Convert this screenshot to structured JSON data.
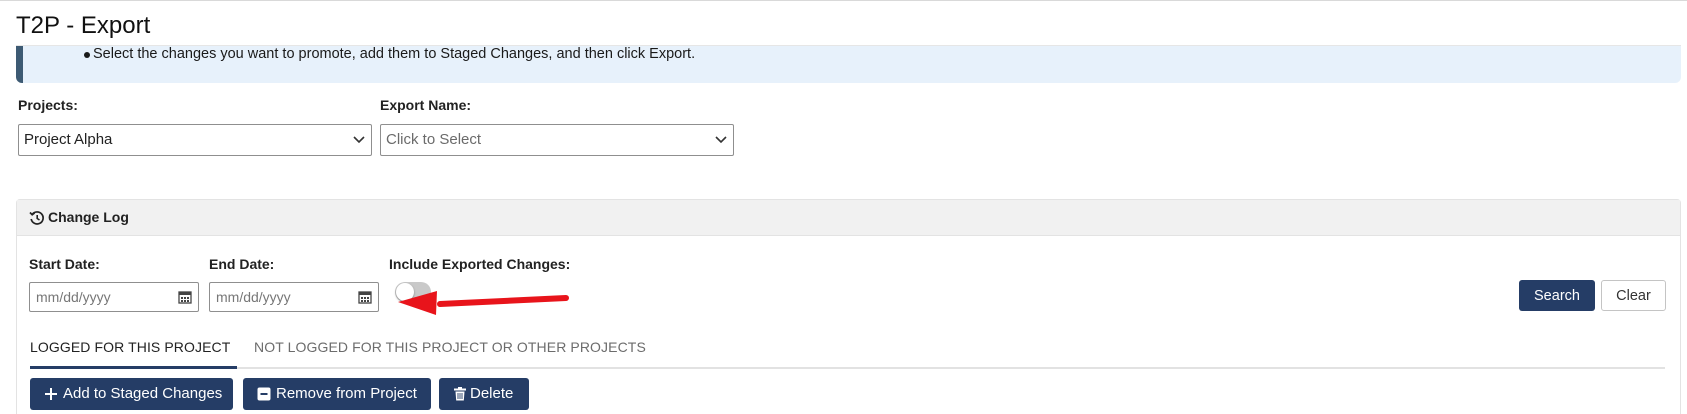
{
  "page": {
    "title": "T2P - Export"
  },
  "info": {
    "bullet_text": "Select the changes you want to promote, add them to Staged Changes, and then click Export."
  },
  "projects": {
    "label": "Projects:",
    "selected": "Project Alpha"
  },
  "export_name": {
    "label": "Export Name:",
    "placeholder": "Click to Select"
  },
  "change_log": {
    "title": "Change Log",
    "start_date": {
      "label": "Start Date:",
      "placeholder": "mm/dd/yyyy"
    },
    "end_date": {
      "label": "End Date:",
      "placeholder": "mm/dd/yyyy"
    },
    "include_exported": {
      "label": "Include Exported Changes:",
      "on": false
    },
    "search_label": "Search",
    "clear_label": "Clear",
    "tabs": [
      {
        "label": "LOGGED FOR THIS PROJECT",
        "active": true
      },
      {
        "label": "NOT LOGGED FOR THIS PROJECT OR OTHER PROJECTS",
        "active": false
      }
    ],
    "actions": {
      "add_label": "Add to Staged Changes",
      "remove_label": "Remove from Project",
      "delete_label": "Delete"
    }
  },
  "annotation": {
    "color": "#e8141b"
  },
  "colors": {
    "primary": "#253d66",
    "info_bg": "#e7f1fb",
    "info_border": "#3d5a73"
  }
}
